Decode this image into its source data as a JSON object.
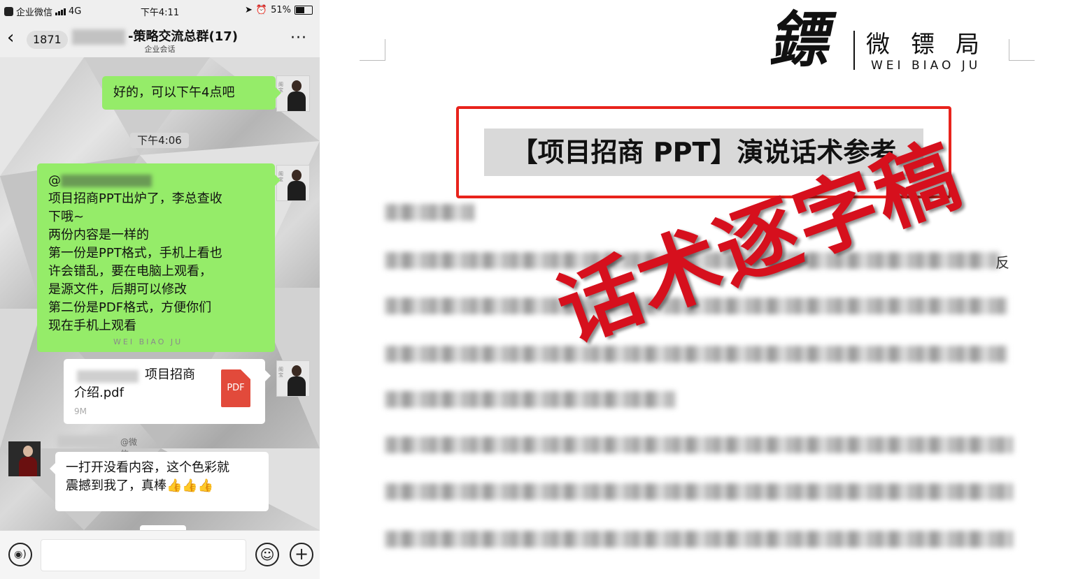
{
  "colors": {
    "chat_green_bubble": "#95ec69",
    "pdf_red": "#e24a3b",
    "stamp_red": "#d6101d",
    "frame_red": "#e8231c"
  },
  "status_bar": {
    "app": "企业微信",
    "network": "4G",
    "time": "下午4:11",
    "battery": "51%"
  },
  "nav": {
    "unread_count": "1871",
    "title": "-策略交流总群(17)",
    "subtitle": "企业会话",
    "more": "···"
  },
  "messages": {
    "m1": "好的，可以下午4点吧",
    "time_divider": "下午4:06",
    "m2_at": "@",
    "m2_l1": "项目招商PPT出炉了，李总查收",
    "m2_l2": "下哦~",
    "m2_l3": "两份内容是一样的",
    "m2_l4": "第一份是PPT格式，手机上看也",
    "m2_l5": "许会错乱，要在电脑上观看，",
    "m2_l6": "是源文件，后期可以修改",
    "m2_l7": "第二份是PDF格式，方便你们",
    "m2_l8": "现在手机上观看",
    "watermark": "WEI BIAO JU",
    "file_name_1": "项目招商",
    "file_name_2": "介绍.pdf",
    "file_size": "9M",
    "file_badge": "PDF",
    "sender_suffix": "@微信",
    "m4_l1": "一打开没看内容，这个色彩就",
    "m4_l2": "震撼到我了，真棒",
    "m4_emoji": "👍👍👍"
  },
  "document": {
    "logo_glyph": "鏢",
    "logo_cn": "微镖局",
    "logo_en": "WEI BIAO JU",
    "title": "【项目招商 PPT】演说话术参考",
    "line_end_char": "反",
    "stamp": "话术逐字稿"
  }
}
